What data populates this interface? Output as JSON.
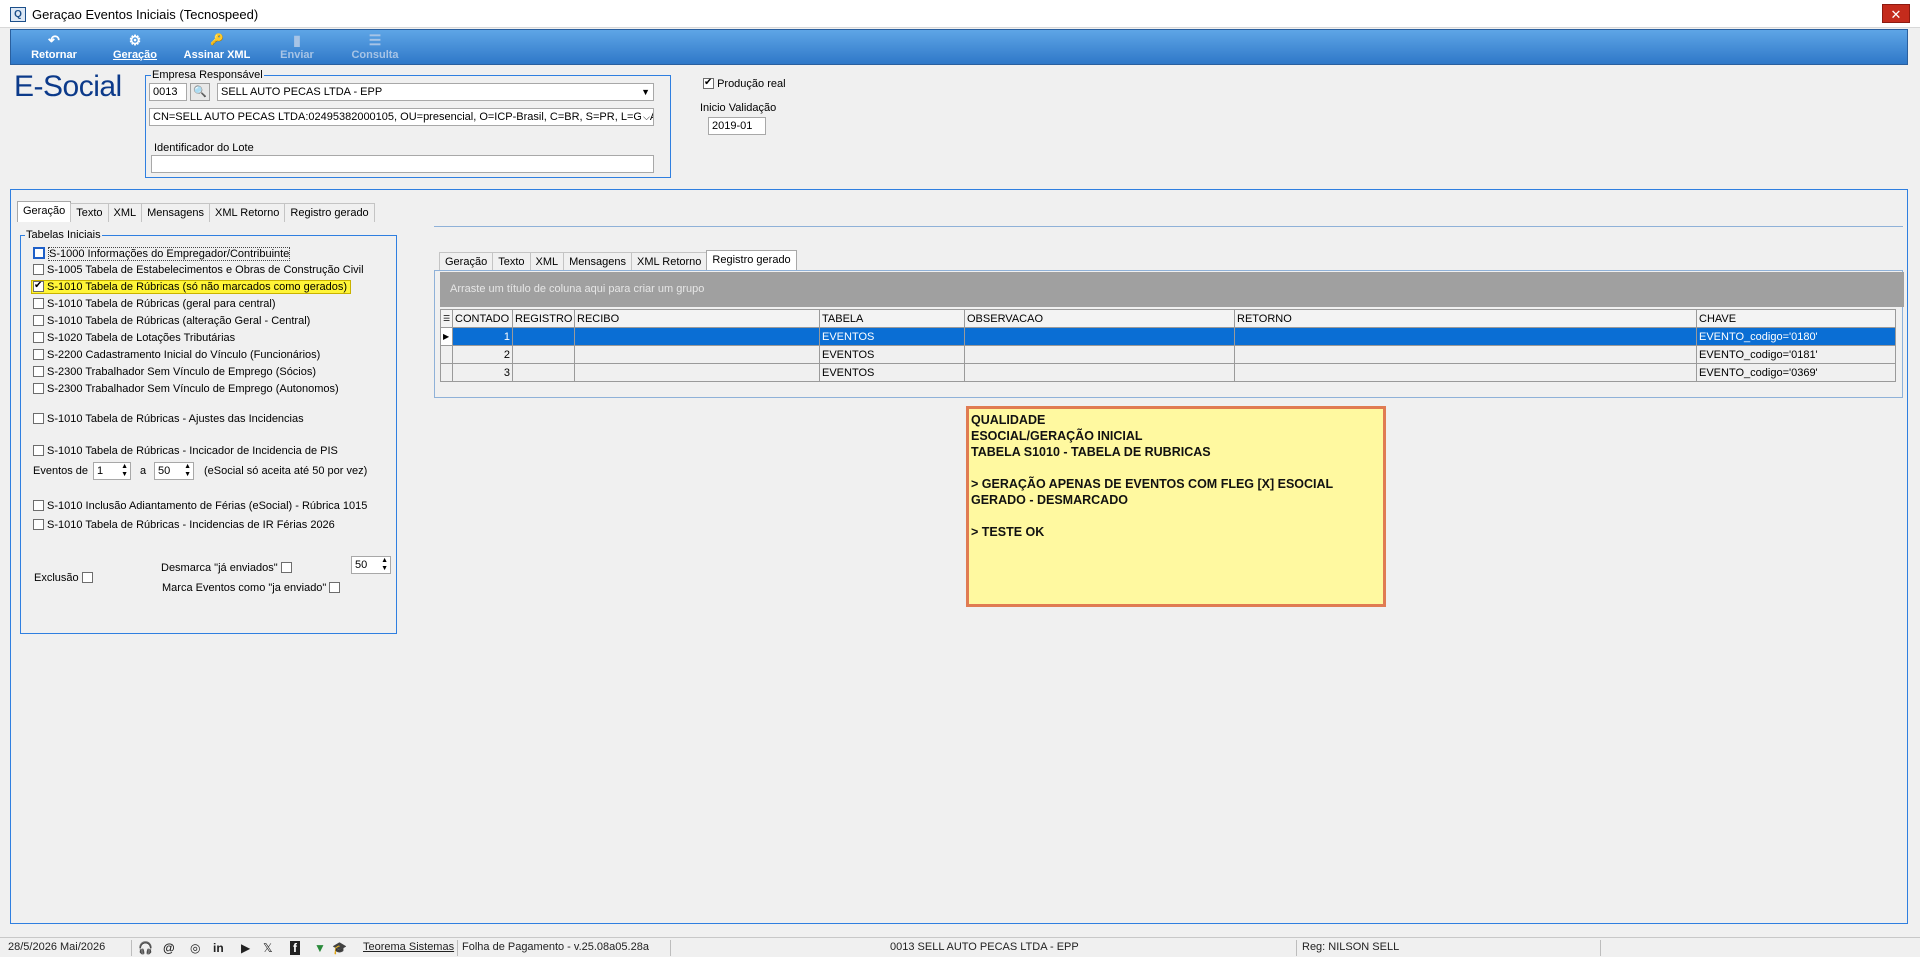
{
  "window": {
    "title": "Geraçao Eventos Iniciais (Tecnospeed)",
    "close_glyph": "✕",
    "app_icon_glyph": "Q"
  },
  "toolbar": {
    "buttons": [
      {
        "label": "Retornar",
        "icon": "undo-icon",
        "glyph": "↶",
        "enabled": true
      },
      {
        "label": "Geração",
        "icon": "document-gear-icon",
        "glyph": "⚙",
        "enabled": true
      },
      {
        "label": "Assinar XML",
        "icon": "sign-key-icon",
        "glyph": "🔑",
        "enabled": true
      },
      {
        "label": "Enviar",
        "icon": "send-icon",
        "glyph": "▮",
        "enabled": false
      },
      {
        "label": "Consulta",
        "icon": "query-document-icon",
        "glyph": "☰",
        "enabled": false
      }
    ]
  },
  "brand": "E-Social",
  "empresa": {
    "legend": "Empresa Responsável",
    "code": "0013",
    "name": "SELL AUTO PECAS LTDA - EPP",
    "certificate": "CN=SELL AUTO PECAS LTDA:02495382000105, OU=presencial, O=ICP-Brasil, C=BR, S=PR, L=GUA",
    "lote_label": "Identificador do Lote",
    "lote_value": ""
  },
  "producao": {
    "label": "Produção real",
    "checked": true
  },
  "inicio_validacao": {
    "label": "Inicio Validação",
    "value": "2019-01"
  },
  "outer_tabs": [
    "Geração",
    "Texto",
    "XML",
    "Mensagens",
    "XML Retorno",
    "Registro gerado"
  ],
  "outer_active_tab": "Geração",
  "tabelas": {
    "legend": "Tabelas Iniciais",
    "items": [
      {
        "label": "S-1000 Informações do Empregador/Contribuinte",
        "checked": false,
        "focus": true
      },
      {
        "label": "S-1005 Tabela de Estabelecimentos e Obras de Construção Civil",
        "checked": false
      },
      {
        "label": "S-1010 Tabela de Rúbricas  (só não marcados como gerados)",
        "checked": true,
        "highlight": true
      },
      {
        "label": "S-1010 Tabela de Rúbricas  (geral para central)",
        "checked": false
      },
      {
        "label": "S-1010 Tabela de Rúbricas  (alteração Geral - Central)",
        "checked": false
      },
      {
        "label": "S-1020 Tabela de Lotações Tributárias",
        "checked": false
      },
      {
        "label": "S-2200 Cadastramento Inicial do Vínculo (Funcionários)",
        "checked": false
      },
      {
        "label": "S-2300 Trabalhador Sem Vínculo de Emprego (Sócios)",
        "checked": false
      },
      {
        "label": "S-2300 Trabalhador Sem Vínculo de Emprego (Autonomos)",
        "checked": false
      },
      {
        "label": "S-1010 Tabela de Rúbricas - Ajustes das Incidencias",
        "checked": false
      },
      {
        "label": "S-1010 Tabela de Rúbricas - Incicador de Incidencia de PIS",
        "checked": false
      },
      {
        "label": "S-1010 Inclusão Adiantamento de Férias (eSocial) - Rúbrica 1015",
        "checked": false
      },
      {
        "label": "S-1010 Tabela de Rúbricas -  Incidencias  de IR Férias 2026",
        "checked": false
      }
    ],
    "eventos_de_label": "Eventos de",
    "eventos_de": "1",
    "eventos_a_label": "a",
    "eventos_a": "50",
    "eventos_note": "(eSocial só aceita até 50 por vez)",
    "exclusao_label": "Exclusão",
    "desmarca_label": "Desmarca \"já enviados\"",
    "desmarca_value": "50",
    "marca_label": "Marca Eventos como \"ja enviado\""
  },
  "inner_tabs": [
    "Geração",
    "Texto",
    "XML",
    "Mensagens",
    "XML Retorno",
    "Registro gerado"
  ],
  "inner_active_tab": "Registro gerado",
  "grid": {
    "group_hint": "Arraste um título de coluna aqui para criar um grupo",
    "columns": [
      "CONTADO",
      "REGISTRO",
      "RECIBO",
      "TABELA",
      "OBSERVACAO",
      "RETORNO",
      "CHAVE"
    ],
    "rows": [
      {
        "contado": "1",
        "registro": "",
        "recibo": "",
        "tabela": "EVENTOS",
        "observacao": "",
        "retorno": "",
        "chave": "EVENTO_codigo='0180'",
        "selected": true
      },
      {
        "contado": "2",
        "registro": "",
        "recibo": "",
        "tabela": "EVENTOS",
        "observacao": "",
        "retorno": "",
        "chave": "EVENTO_codigo='0181'",
        "selected": false
      },
      {
        "contado": "3",
        "registro": "",
        "recibo": "",
        "tabela": "EVENTOS",
        "observacao": "",
        "retorno": "",
        "chave": "EVENTO_codigo='0369'",
        "selected": false
      }
    ]
  },
  "note": {
    "lines": [
      "QUALIDADE",
      "ESOCIAL/GERAÇÃO INICIAL",
      "TABELA S1010 - TABELA DE RUBRICAS",
      "",
      "> GERAÇÃO APENAS DE EVENTOS COM FLEG [X] ESOCIAL GERADO - DESMARCADO",
      "",
      "> TESTE OK"
    ]
  },
  "status": {
    "date": "28/5/2026 Mai/2026",
    "company_link": "Teorema Sistemas",
    "version": "Folha de Pagamento - v.25.08a05.28a",
    "company": "0013 SELL AUTO PECAS LTDA - EPP",
    "reg": "Reg: NILSON SELL",
    "icons": [
      {
        "name": "headset-icon",
        "glyph": "🎧"
      },
      {
        "name": "at-icon",
        "glyph": "@"
      },
      {
        "name": "instagram-icon",
        "glyph": "◎"
      },
      {
        "name": "linkedin-icon",
        "glyph": "in"
      },
      {
        "name": "youtube-icon",
        "glyph": "▶"
      },
      {
        "name": "x-icon",
        "glyph": "𝕏"
      },
      {
        "name": "facebook-icon",
        "glyph": "f"
      },
      {
        "name": "tree-icon",
        "glyph": "▼"
      },
      {
        "name": "graduation-cap-icon",
        "glyph": "🎓"
      }
    ]
  },
  "colors": {
    "accent_border": "#2f7fe0",
    "selection": "#0a6ed4",
    "highlight": "#fff538",
    "note_bg": "#fff9a0",
    "note_border": "#e07b52"
  }
}
